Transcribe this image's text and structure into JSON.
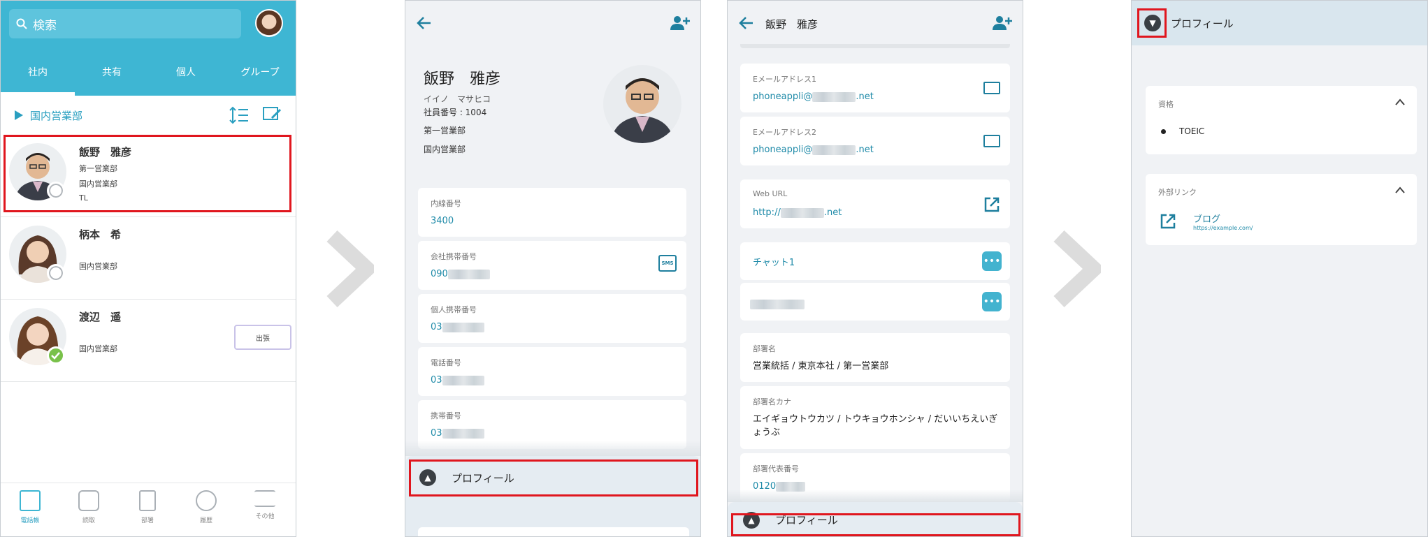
{
  "screen1": {
    "search_placeholder": "検索",
    "tabs": [
      "社内",
      "共有",
      "個人",
      "グループ"
    ],
    "section": "国内営業部",
    "contacts": [
      {
        "name": "飯野　雅彦",
        "lines": [
          "第一営業部",
          "国内営業部",
          "TL"
        ]
      },
      {
        "name": "柄本　希",
        "lines": [
          "",
          "国内営業部",
          ""
        ]
      },
      {
        "name": "渡辺　遥",
        "lines": [
          "",
          "国内営業部",
          ""
        ],
        "status_button": "出張"
      }
    ],
    "bottom_nav": [
      "電話帳",
      "読取",
      "部署",
      "履歴",
      "その他"
    ]
  },
  "screen2": {
    "name": "飯野　雅彦",
    "kana": "イイノ　マサヒコ",
    "employee_no": "社員番号 : 1004",
    "dept1": "第一営業部",
    "dept2": "国内営業部",
    "fields": [
      {
        "label": "内線番号",
        "value": "3400"
      },
      {
        "label": "会社携帯番号",
        "value": "090"
      },
      {
        "label": "個人携帯番号",
        "value": "03"
      },
      {
        "label": "電話番号",
        "value": "03"
      },
      {
        "label": "携帯番号",
        "value": "03"
      }
    ],
    "sms_label": "SMS",
    "profile_bar": "プロフィール"
  },
  "screen3": {
    "header_name": "飯野　雅彦",
    "email1_label": "Eメールアドレス1",
    "email1_prefix": "phoneappli@",
    "email1_suffix": ".net",
    "email2_label": "Eメールアドレス2",
    "email2_prefix": "phoneappli@",
    "email2_suffix": ".net",
    "web_label": "Web URL",
    "web_prefix": "http://",
    "web_suffix": ".net",
    "chat1": "チャット1",
    "dept_label": "部署名",
    "dept_value": "営業統括 / 東京本社 / 第一営業部",
    "dept_kana_label": "部署名カナ",
    "dept_kana_value": "エイギョウトウカツ / トウキョウホンシャ / だいいちえいぎょうぶ",
    "dept_phone_label": "部署代表番号",
    "dept_phone_value": "0120",
    "profile_bar": "プロフィール"
  },
  "screen4": {
    "header": "プロフィール",
    "qual_label": "資格",
    "qual_item": "TOEIC",
    "links_label": "外部リンク",
    "link_title": "ブログ",
    "link_url": "https://example.com/"
  },
  "colors": {
    "accent": "#3eb6d3",
    "link": "#1e8aa8",
    "highlight": "#e0161e"
  }
}
